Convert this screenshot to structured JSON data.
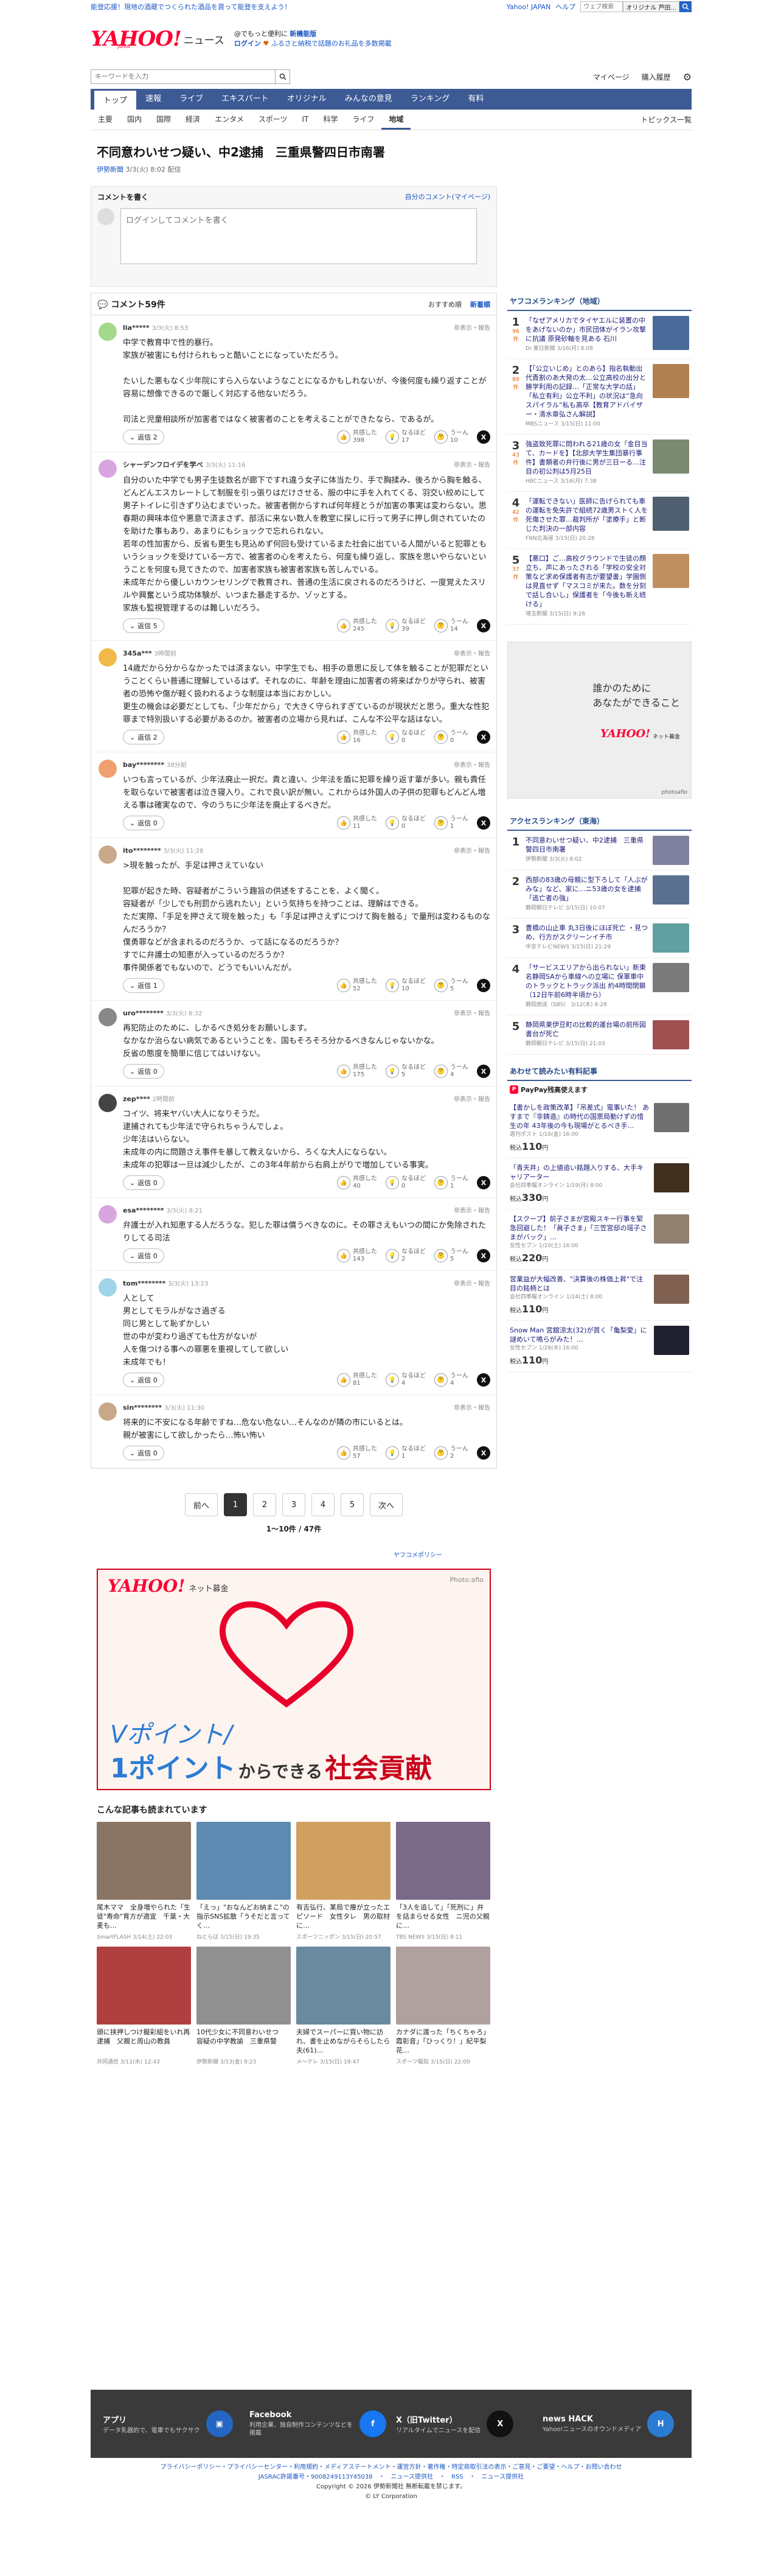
{
  "top": {
    "promo": "能登応援！現地の酒蔵でつくられた酒品を買って能登を支えよう！",
    "links": [
      "Yahoo! JAPAN",
      "ヘルプ"
    ],
    "search_placeholder": "ウェブ検索",
    "search_btn": "オリジナル 芦田..."
  },
  "header": {
    "site": "ニュース",
    "line1a": "@でもっと便利に",
    "line1b": "新機能版",
    "line2a": "ログイン",
    "line2b": "ふるさと納税で話題のお礼品を多数掲載"
  },
  "search": {
    "placeholder": "キーワードを入力",
    "links": [
      "マイページ",
      "購入履歴"
    ]
  },
  "nav": [
    "トップ",
    "速報",
    "ライブ",
    "エキスパート",
    "オリジナル",
    "みんなの意見",
    "ランキング",
    "有料"
  ],
  "subnav": [
    "主要",
    "国内",
    "国際",
    "経済",
    "エンタメ",
    "スポーツ",
    "IT",
    "科学",
    "ライフ",
    "地域"
  ],
  "subnav_active": "地域",
  "topics": "トピックス一覧",
  "article": {
    "title": "不同意わいせつ疑い、中2逮捕　三重県警四日市南署",
    "source": "伊勢新聞",
    "date": "3/3(火) 8:02 配信"
  },
  "comment_write": {
    "heading": "コメントを書く",
    "my_link": "自分のコメント(マイページ)",
    "placeholder": "ログインしてコメントを書く"
  },
  "comments_head": {
    "count": "コメント59件",
    "sort1": "おすすめ順",
    "sort2": "新着順"
  },
  "report": "非表示・報告",
  "reply_btn": "返信",
  "react_labels": [
    "共感した",
    "なるほど",
    "うーん"
  ],
  "comments": [
    {
      "name": "lia*****",
      "time": "3/3(火) 8:53",
      "color": "#a4d88a",
      "replies": "2",
      "body": "中学で教育中で性的暴行。\n家族が被害にも付けられもっと酷いことになっていただろう。\n\nたいした悪もなく少年院にすら入らないようなことになるかもしれないが、今後何度も繰り返すことが容易に想像できるので厳しく対応する他ないだろう。\n\n司法と児童相談所が加害者ではなく被害者のことを考えることができたなら、であるが。",
      "r": [
        "398",
        "17",
        "10"
      ]
    },
    {
      "name": "シャーデンフロイデを学べ",
      "time": "3/3(火) 11:16",
      "color": "#d9a5e0",
      "replies": "5",
      "body": "自分のいた中学でも男子生徒数名が廊下ですれ違う女子に体当たり、手で胸揉み、後ろから胸を触る、どんどんエスカレートして制服を引っ張りはだけさせる、服の中に手を入れてくる、羽交い絞めにして男子トイレに引きずり込むまでいった。被害者側からすれば何年経とうが加害の事実は変わらない。思春期の興味本位や悪意で済まさず、部活に来ない数人を教室に探しに行って男子に押し倒されていたのを助けた事もあり、あまりにもショックで忘れられない。\n若年の性加害から、反省も更生も見込めず何回も受けているまた社会に出ている人間がいると犯罪ともいうショックを受けている一方で、被害者の心を考えたら、何度も繰り返し、家族を思いやらないということを何度も見てきたので、加害者家族も被害者家族も苦しんでいる。\n未成年だから優しいカウンセリングで教育され、普通の生活に戻されるのだろうけど、一度覚えたスリルや興奮という成功体験が、いつまた暴走するか、ゾッとする。\n家族も監視管理するのは難しいだろう。",
      "r": [
        "245",
        "39",
        "14"
      ]
    },
    {
      "name": "345a***",
      "time": "3時間前",
      "color": "#f1b84a",
      "replies": "2",
      "body": "14歳だから分からなかったでは済まない。中学生でも、相手の意思に反して体を触ることが犯罪だということくらい普通に理解しているはず。それなのに、年齢を理由に加害者の将来ばかりが守られ、被害者の恐怖や傷が軽く扱われるような制度は本当におかしい。\n更生の機会は必要だとしても、「少年だから」で大きく守られすぎているのが現状だと思う。重大な性犯罪まで特別扱いする必要があるのか。被害者の立場から見れば、こんな不公平な話はない。",
      "r": [
        "16",
        "0",
        "0"
      ]
    },
    {
      "name": "bay********",
      "time": "38分前",
      "color": "#f0a070",
      "replies": "0",
      "body": "いつも言っているが、少年法廃止一択だ。責と違い、少年法を盾に犯罪を繰り返す輩が多い。親も責任を取らないで被害者は泣き寝入り。これで良い訳が無い。これからは外国人の子供の犯罪もどんどん増える事は確実なので、今のうちに少年法を廃止するべきだ。",
      "r": [
        "11",
        "0",
        "1"
      ]
    },
    {
      "name": "ito********",
      "time": "3/3(火) 11:28",
      "color": "#c8a888",
      "replies": "1",
      "body": ">現を触ったが、手足は押さえていない\n\n犯罪が起きた時、容疑者がこういう趣旨の供述をすることを、よく聞く。\n容疑者が「少しでも刑罰から逃れたい」という気持ちを持つことは、理解はできる。\nただ実際、「手足を押さえて現を触った」も「手足は押さえずにつけて胸を触る」で量刑は変わるものなんだろうか？\n僕勇罪などが含まれるのだろうか、って話になるのだろうか？\nすでに弁護士の知恵が入っているのだろうか？\n事件関係者でもないので、どうでもいいんだが。",
      "r": [
        "52",
        "10",
        "5"
      ]
    },
    {
      "name": "uro********",
      "time": "3/3(火) 8:32",
      "color": "#888888",
      "replies": "0",
      "body": "再犯防止のために、しかるべき処分をお願いします。\nなかなか治らない病気であるということを、国もそろそろ分かるべきなんじゃないかな。\n反省の態度を簡単に信じてはいけない。",
      "r": [
        "175",
        "5",
        "4"
      ]
    },
    {
      "name": "zep****",
      "time": "2時間前",
      "color": "#444444",
      "replies": "0",
      "body": "コイツ、将来ヤバい大人になりそうだ。\n逮捕されても少年法で守られちゃうんでしょ。\n少年法はいらない。\n未成年の内に問題さえ事件を暴して教えないから、ろくな大人にならない。\n未成年の犯罪は一旦は減少したが、この3年4年前から右肩上がりで増加している事実。",
      "r": [
        "40",
        "0",
        "1"
      ]
    },
    {
      "name": "esa********",
      "time": "3/3(火) 8:21",
      "color": "#d9a5e0",
      "replies": "0",
      "body": "弁護士が入れ知恵する人だろうな。犯した罪は償うべきなのに。その罪さえもいつの間にか免除されたりしてる司法",
      "r": [
        "143",
        "2",
        "5"
      ]
    },
    {
      "name": "tom********",
      "time": "3/3(火) 13:23",
      "color": "#a0d4e8",
      "replies": "0",
      "body": "人として\n男としてモラルがなさ過ぎる\n同じ男として恥ずかしい\n世の中が変わり過ぎても仕方がないが\n人を傷つける事への罪悪を重視してして欲しい\n未成年でも！",
      "r": [
        "81",
        "4",
        "4"
      ]
    },
    {
      "name": "sin********",
      "time": "3/3(火) 11:30",
      "color": "#c8a888",
      "replies": "0",
      "body": "将来的に不安になる年齢ですね…危ない危ない…そんなのが隣の市にいるとは。\n親が被害にして欲しかったら…怖い怖い",
      "r": [
        "57",
        "1",
        "2"
      ]
    }
  ],
  "pager": {
    "prev": "前へ",
    "pages": [
      "1",
      "2",
      "3",
      "4",
      "5"
    ],
    "next": "次へ",
    "count": "1〜10件 / 47件"
  },
  "policy": "ヤフコメポリシー",
  "bigad": {
    "brand": "YAHOO!",
    "sub": "ネット募金",
    "credit": "Photo:afio",
    "c1": "Vポイント/",
    "c2a": "1ポイント",
    "c2b": "からできる",
    "c2c": "社会貢献"
  },
  "recommended": {
    "heading": "こんな記事も読まれています",
    "items": [
      {
        "t": "尾木ママ　全身増やられた「生徒\"寿命\"育方が適宜　千葉・大麦も…",
        "s": "SmartFLASH",
        "d": "3/14(土) 22:03"
      },
      {
        "t": "「えっ」\"おなんどお納まこ\"の指示SNS拡散「うそだと言ってく…",
        "s": "ねとらぼ",
        "d": "3/15(日) 19:35"
      },
      {
        "t": "有吉弘行、某局で痩が立ったエピソード　女性タレ　男の取材に…",
        "s": "スポーツニッポン",
        "d": "3/15(日) 20:57"
      },
      {
        "t": "「3人を追して」「死刑に」弁を話まらせる女性　ニ児の父親に…",
        "s": "TBS NEWS",
        "d": "3/15(日) 8:11"
      },
      {
        "t": "頭に挟押しつけ擬彩組をいれ再逮捕　父親と周山の教員",
        "s": "共同通信",
        "d": "3/11(水) 12:43"
      },
      {
        "t": "10代少女に不同意わいせつ　容疑の中学教諭　三重県警",
        "s": "伊勢新聞",
        "d": "3/13(金) 8:23"
      },
      {
        "t": "夫婦でスーパーに買い物に訪れ、書を止めながらそらしたら夫(61)…",
        "s": "メ〜テレ",
        "d": "3/15(日) 19:47"
      },
      {
        "t": "カナダに渡った「ちくちゃろ」霞彰音」「ひっくり！」紀平梨花…",
        "s": "スポーツ報知",
        "d": "3/15(日) 22:00"
      }
    ]
  },
  "sidebar": {
    "rank_head": "ヤフコメランキング（地域）",
    "ranking": [
      {
        "n": "1",
        "c": "96件",
        "t": "「なぜアメリカでタイヤエルに装置の中をあげないのか」市民団体がイラン攻撃に抗議 原発砂軸を見ある 石川",
        "s": "Dr.東日新聞 3/16(月) 8:08"
      },
      {
        "n": "2",
        "c": "89件",
        "t": "【「公立いじめ」とのあら】指名執動出代責割のあ大発の太…公立高校の出分と勝学利用の記録…「正常な大学の話」「私立有利」公立不利」の状況は“急向スパイラル”私も高卒【教育アドバイザー・清水章弘さん解説】",
        "s": "MBSニュース 3/15(日) 11:00"
      },
      {
        "n": "3",
        "c": "43件",
        "t": "強盗致死罪に問われる21歳の女「金目当て、カードを】【北部大学生集団暴行事件】書類者の弁行後に男が三日ーる…注目の初公判は5月25日",
        "s": "HBCニュース 3/16(月) 7:38"
      },
      {
        "n": "4",
        "c": "42件",
        "t": "「運転できない」医師に告げられても車の運転を免失許で組続72歳男ストく人を死傷させた罪…裁判所が「塗療手」と断じた判決の一部内容",
        "s": "FNN北海道 3/15(日) 20:28"
      },
      {
        "n": "5",
        "c": "37件",
        "t": "【悪口】ご…高校グラウンドで生徒の顔立ち、声にあったされる「学校の安全対策など求め保護者有志が要望書」学園側は見直せず「マスコミが来た。数を分刻で話し合いし」保護者を「今後も新え続ける」",
        "s": "埼玉新聞 3/15(日) 9:26"
      }
    ],
    "ad": {
      "text": "誰かのために\nあなたができること",
      "brand": "YAHOO!",
      "sub": "ネット募金",
      "credit": "photoafio"
    },
    "access_head": "アクセスランキング（東海）",
    "access": [
      {
        "n": "1",
        "t": "不同意わいせつ疑い、中2逮捕　三重県警四日市南署",
        "s": "伊勢新聞 3/3(火) 8:02"
      },
      {
        "n": "2",
        "t": "西部の83歳の母親に型下ろして「人ぶがみな」など、家に…ニ53歳の女を逮捕「逃亡者の強」",
        "s": "静岡朝日テレビ 3/15(日) 10:07"
      },
      {
        "n": "3",
        "t": "豊橋の山止車 丸3日後にほぼ死亡 ・見つめ、行方がスクリーンイチ市",
        "s": "中京テレビNEWS 3/15(日) 21:29"
      },
      {
        "n": "4",
        "t": "「サービスエリアから出られない」新東名静岡SAから車線への立場に 保軍車中のトラックとトラック派出 約4時間閉鎖（12日午前6時半頃から）",
        "s": "静岡放送（SBS） 3/12(木) 8:28"
      },
      {
        "n": "5",
        "t": "静岡県東伊豆町の比較的運台場の前所図書台が死亡",
        "s": "静岡朝日テレビ 3/15(日) 21:03"
      }
    ],
    "shop_head": "あわせて読みたい有料記事",
    "shop_pay": "PayPay残高使えます",
    "shop": [
      {
        "t": "【書かしを政策改革】「吊差式」電事いた！ あすまで『非鋳造』の時代の国票局動けずの惜生の年 43年後の今も現場がとるべき手…",
        "s": "週刊ポスト 1/16(金) 16:00",
        "p": "110"
      },
      {
        "t": "「青天井」の上値追い銘題入りする、大手キャリアーター",
        "s": "会社四季報オンライン 1/19(月) 8:00",
        "p": "330"
      },
      {
        "t": "【スクープ】前子さまが宮殿スキー行事を緊急回避した！「眞子さま」「三笠宮邸の瑶子さまがバック」…",
        "s": "女性セブン 1/10(土) 16:00",
        "p": "220"
      },
      {
        "t": "営業益が大幅改善、\"決算後の株価上昇\"で注目の銘柄とは",
        "s": "会社四季報オンライン 1/24(土) 8:00",
        "p": "110"
      },
      {
        "t": "Snow Man 宮舘涼太(32)が買く「亀梨愛」に謎めいて鳴らがみた！…",
        "s": "女性セブン 1/28(水) 16:00",
        "p": "110"
      }
    ]
  },
  "footer": [
    {
      "b": "アプリ",
      "s": "データ乳器的で、電車でもサクサク",
      "icon": "app-icon",
      "c": "#2466c4",
      "g": "▣"
    },
    {
      "b": "Facebook",
      "s": "利用企業、独自制作コンテンツなどを掲載",
      "icon": "facebook-icon",
      "c": "#1877f2",
      "g": "f"
    },
    {
      "b": "X（旧Twitter）",
      "s": "リアルタイムでニュースを配信",
      "icon": "x-icon",
      "c": "#111",
      "g": "X"
    },
    {
      "b": "news HACK",
      "s": "Yahoo!ニュースのオウンドメディア",
      "icon": "newshack-icon",
      "c": "#2a7bd4",
      "g": "H"
    }
  ],
  "footer_links": "プライバシーポリシー・プライバシーセンター・利用規約・メディアステートメント・運営方針・著作権・特定商取引法の表示・ご意見・ご要望・ヘルプ・お問い合わせ",
  "footer_links2": "JASRAC許諾番号・9008249113Y45038　・　ニュース提供社　・　RSS　・　ニュース提供社",
  "copyright": "Copyright © 2026 伊勢新聞社 無断転載を禁じます。",
  "copyright2": "© LY Corporation"
}
